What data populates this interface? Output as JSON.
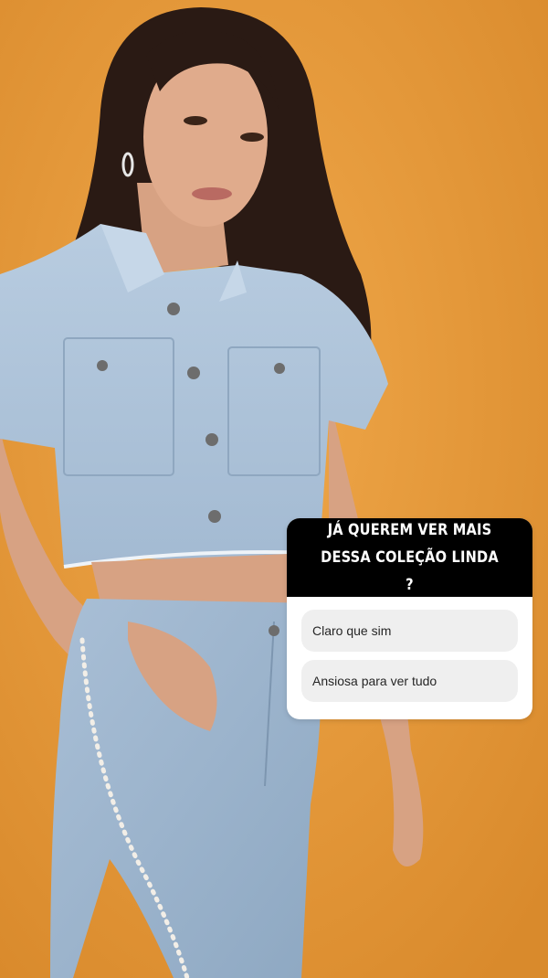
{
  "poll": {
    "question": "JÁ QUEREM VER MAIS DESSA COLEÇÃO LINDA ?",
    "options": [
      {
        "label": "Claro que sim"
      },
      {
        "label": "Ansiosa para ver tudo"
      }
    ]
  },
  "colors": {
    "background": "#e79a3a",
    "poll_header": "#000000",
    "poll_option_bg": "#efefef"
  }
}
